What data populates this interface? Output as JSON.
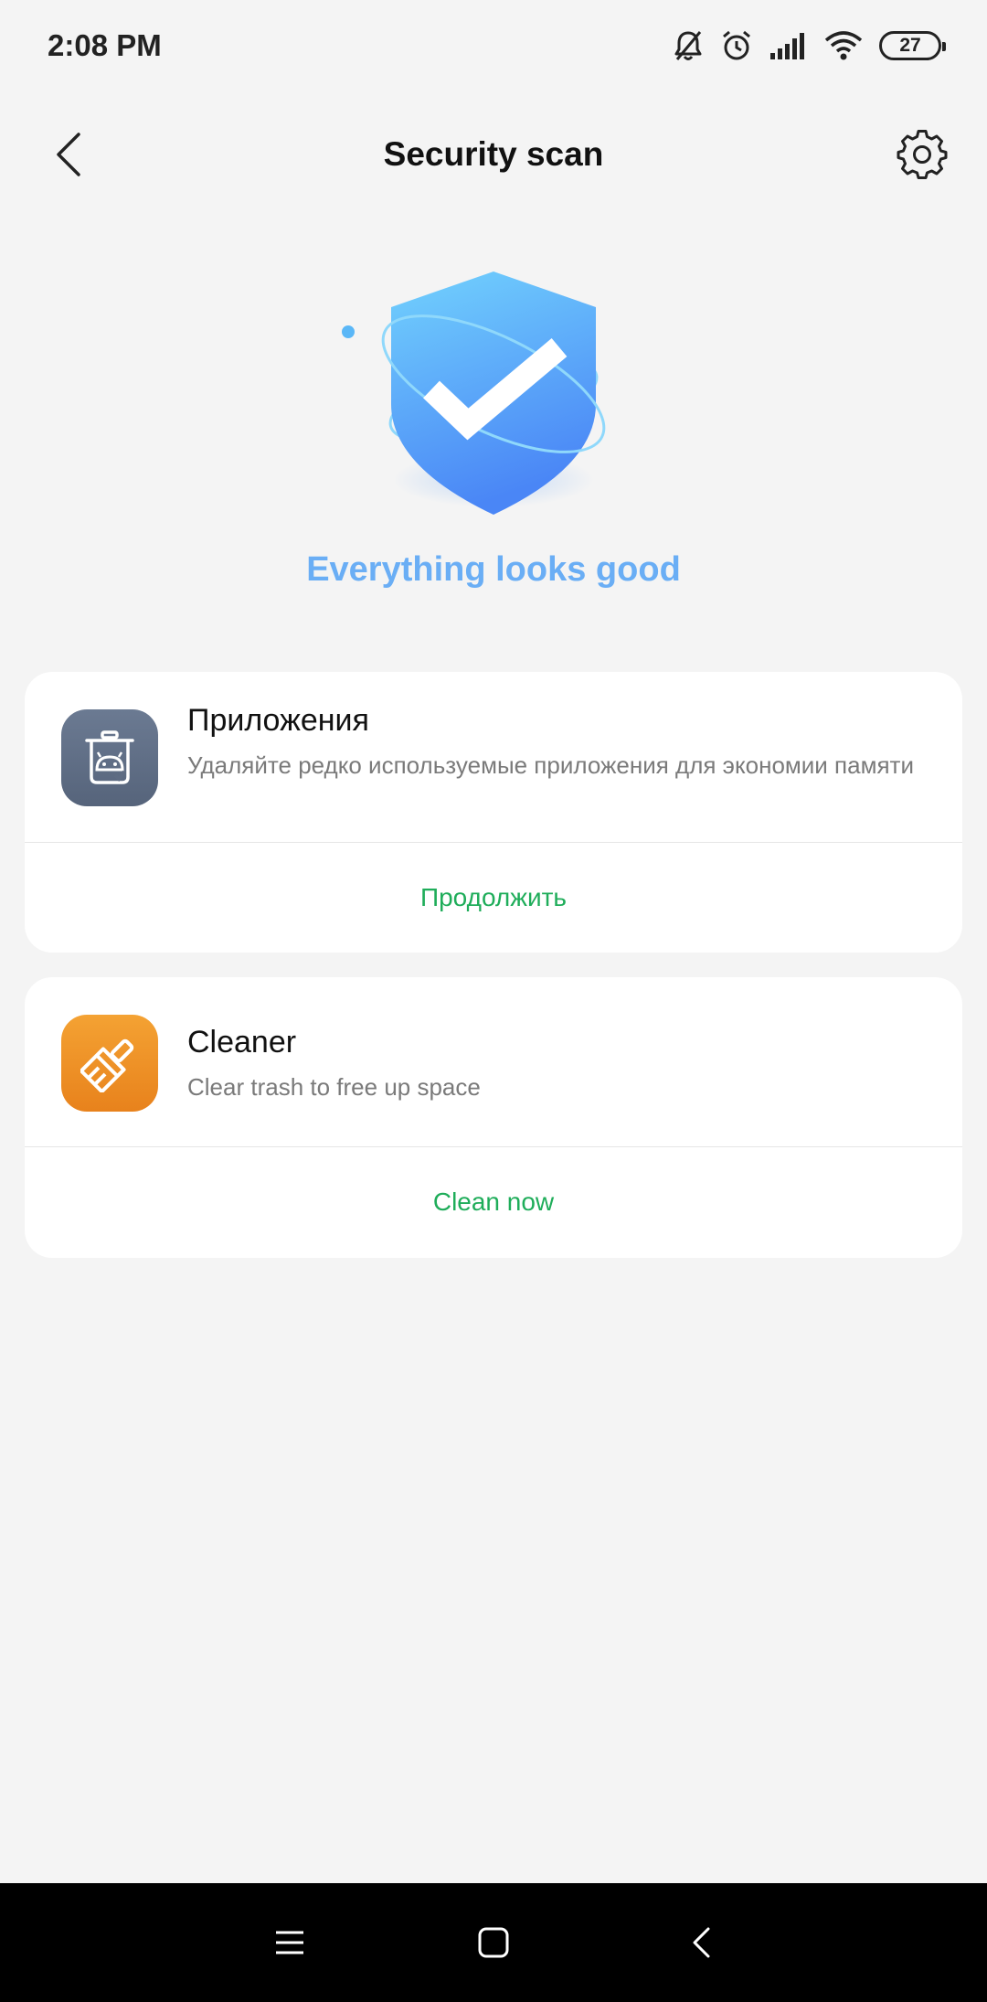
{
  "status_bar": {
    "time": "2:08 PM",
    "battery_level": "27",
    "icons": [
      "bell-off-icon",
      "alarm-icon",
      "signal-icon",
      "wifi-icon",
      "battery-icon"
    ]
  },
  "header": {
    "title": "Security scan",
    "back_icon": "chevron-left-icon",
    "settings_icon": "gear-icon"
  },
  "hero": {
    "status_text": "Everything looks good",
    "icon": "shield-check-icon"
  },
  "cards": [
    {
      "title": "Приложения",
      "description": "Удаляйте редко используемые приложения для экономии памяти",
      "action_label": "Продолжить",
      "icon": "trash-bin-icon"
    },
    {
      "title": "Cleaner",
      "description": "Clear trash to free up space",
      "action_label": "Clean now",
      "icon": "brush-icon"
    }
  ],
  "nav_bar": {
    "icons": [
      "menu-icon",
      "home-icon",
      "back-icon"
    ]
  },
  "colors": {
    "background": "#f4f4f4",
    "accent_green": "#1fad5a",
    "status_blue": "#6aaef5",
    "apps_icon_bg": "#5f6d84",
    "cleaner_icon_bg": "#ee9026"
  }
}
